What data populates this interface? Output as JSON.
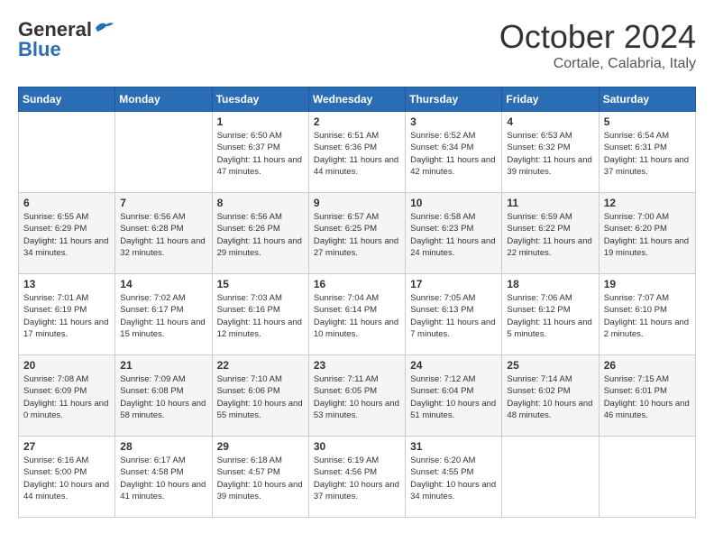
{
  "header": {
    "logo_general": "General",
    "logo_blue": "Blue",
    "month_title": "October 2024",
    "location": "Cortale, Calabria, Italy"
  },
  "calendar": {
    "days_of_week": [
      "Sunday",
      "Monday",
      "Tuesday",
      "Wednesday",
      "Thursday",
      "Friday",
      "Saturday"
    ],
    "weeks": [
      [
        {
          "day": "",
          "content": ""
        },
        {
          "day": "",
          "content": ""
        },
        {
          "day": "1",
          "content": "Sunrise: 6:50 AM\nSunset: 6:37 PM\nDaylight: 11 hours and 47 minutes."
        },
        {
          "day": "2",
          "content": "Sunrise: 6:51 AM\nSunset: 6:36 PM\nDaylight: 11 hours and 44 minutes."
        },
        {
          "day": "3",
          "content": "Sunrise: 6:52 AM\nSunset: 6:34 PM\nDaylight: 11 hours and 42 minutes."
        },
        {
          "day": "4",
          "content": "Sunrise: 6:53 AM\nSunset: 6:32 PM\nDaylight: 11 hours and 39 minutes."
        },
        {
          "day": "5",
          "content": "Sunrise: 6:54 AM\nSunset: 6:31 PM\nDaylight: 11 hours and 37 minutes."
        }
      ],
      [
        {
          "day": "6",
          "content": "Sunrise: 6:55 AM\nSunset: 6:29 PM\nDaylight: 11 hours and 34 minutes."
        },
        {
          "day": "7",
          "content": "Sunrise: 6:56 AM\nSunset: 6:28 PM\nDaylight: 11 hours and 32 minutes."
        },
        {
          "day": "8",
          "content": "Sunrise: 6:56 AM\nSunset: 6:26 PM\nDaylight: 11 hours and 29 minutes."
        },
        {
          "day": "9",
          "content": "Sunrise: 6:57 AM\nSunset: 6:25 PM\nDaylight: 11 hours and 27 minutes."
        },
        {
          "day": "10",
          "content": "Sunrise: 6:58 AM\nSunset: 6:23 PM\nDaylight: 11 hours and 24 minutes."
        },
        {
          "day": "11",
          "content": "Sunrise: 6:59 AM\nSunset: 6:22 PM\nDaylight: 11 hours and 22 minutes."
        },
        {
          "day": "12",
          "content": "Sunrise: 7:00 AM\nSunset: 6:20 PM\nDaylight: 11 hours and 19 minutes."
        }
      ],
      [
        {
          "day": "13",
          "content": "Sunrise: 7:01 AM\nSunset: 6:19 PM\nDaylight: 11 hours and 17 minutes."
        },
        {
          "day": "14",
          "content": "Sunrise: 7:02 AM\nSunset: 6:17 PM\nDaylight: 11 hours and 15 minutes."
        },
        {
          "day": "15",
          "content": "Sunrise: 7:03 AM\nSunset: 6:16 PM\nDaylight: 11 hours and 12 minutes."
        },
        {
          "day": "16",
          "content": "Sunrise: 7:04 AM\nSunset: 6:14 PM\nDaylight: 11 hours and 10 minutes."
        },
        {
          "day": "17",
          "content": "Sunrise: 7:05 AM\nSunset: 6:13 PM\nDaylight: 11 hours and 7 minutes."
        },
        {
          "day": "18",
          "content": "Sunrise: 7:06 AM\nSunset: 6:12 PM\nDaylight: 11 hours and 5 minutes."
        },
        {
          "day": "19",
          "content": "Sunrise: 7:07 AM\nSunset: 6:10 PM\nDaylight: 11 hours and 2 minutes."
        }
      ],
      [
        {
          "day": "20",
          "content": "Sunrise: 7:08 AM\nSunset: 6:09 PM\nDaylight: 11 hours and 0 minutes."
        },
        {
          "day": "21",
          "content": "Sunrise: 7:09 AM\nSunset: 6:08 PM\nDaylight: 10 hours and 58 minutes."
        },
        {
          "day": "22",
          "content": "Sunrise: 7:10 AM\nSunset: 6:06 PM\nDaylight: 10 hours and 55 minutes."
        },
        {
          "day": "23",
          "content": "Sunrise: 7:11 AM\nSunset: 6:05 PM\nDaylight: 10 hours and 53 minutes."
        },
        {
          "day": "24",
          "content": "Sunrise: 7:12 AM\nSunset: 6:04 PM\nDaylight: 10 hours and 51 minutes."
        },
        {
          "day": "25",
          "content": "Sunrise: 7:14 AM\nSunset: 6:02 PM\nDaylight: 10 hours and 48 minutes."
        },
        {
          "day": "26",
          "content": "Sunrise: 7:15 AM\nSunset: 6:01 PM\nDaylight: 10 hours and 46 minutes."
        }
      ],
      [
        {
          "day": "27",
          "content": "Sunrise: 6:16 AM\nSunset: 5:00 PM\nDaylight: 10 hours and 44 minutes."
        },
        {
          "day": "28",
          "content": "Sunrise: 6:17 AM\nSunset: 4:58 PM\nDaylight: 10 hours and 41 minutes."
        },
        {
          "day": "29",
          "content": "Sunrise: 6:18 AM\nSunset: 4:57 PM\nDaylight: 10 hours and 39 minutes."
        },
        {
          "day": "30",
          "content": "Sunrise: 6:19 AM\nSunset: 4:56 PM\nDaylight: 10 hours and 37 minutes."
        },
        {
          "day": "31",
          "content": "Sunrise: 6:20 AM\nSunset: 4:55 PM\nDaylight: 10 hours and 34 minutes."
        },
        {
          "day": "",
          "content": ""
        },
        {
          "day": "",
          "content": ""
        }
      ]
    ]
  }
}
